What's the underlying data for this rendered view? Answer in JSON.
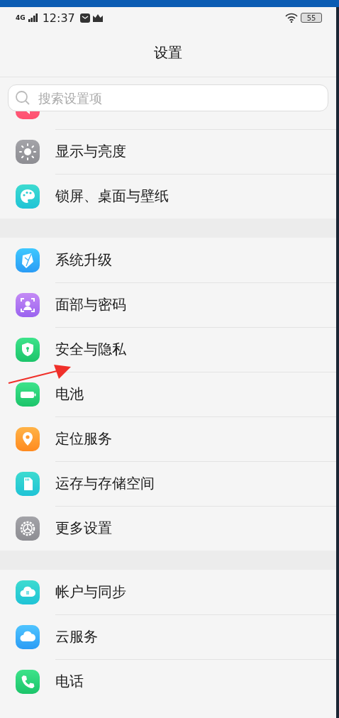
{
  "status_bar": {
    "network": "4G",
    "time": "12:37",
    "battery": "55"
  },
  "title": "设置",
  "search": {
    "placeholder": "搜索设置项"
  },
  "groups": [
    {
      "items": [
        {
          "kind": "sound"
        },
        {
          "kind": "display",
          "label": "显示与亮度"
        },
        {
          "kind": "palette",
          "label": "锁屏、桌面与壁纸"
        }
      ]
    },
    {
      "items": [
        {
          "kind": "upgrade",
          "label": "系统升级"
        },
        {
          "kind": "face",
          "label": "面部与密码"
        },
        {
          "kind": "shield",
          "label": "安全与隐私"
        },
        {
          "kind": "battery",
          "label": "电池"
        },
        {
          "kind": "location",
          "label": "定位服务"
        },
        {
          "kind": "storage",
          "label": "运存与存储空间"
        },
        {
          "kind": "more",
          "label": "更多设置"
        }
      ]
    },
    {
      "items": [
        {
          "kind": "account",
          "label": "帐户与同步"
        },
        {
          "kind": "cloud",
          "label": "云服务"
        },
        {
          "kind": "phone",
          "label": "电话"
        }
      ]
    }
  ],
  "annotation": {
    "kind": "arrow"
  }
}
